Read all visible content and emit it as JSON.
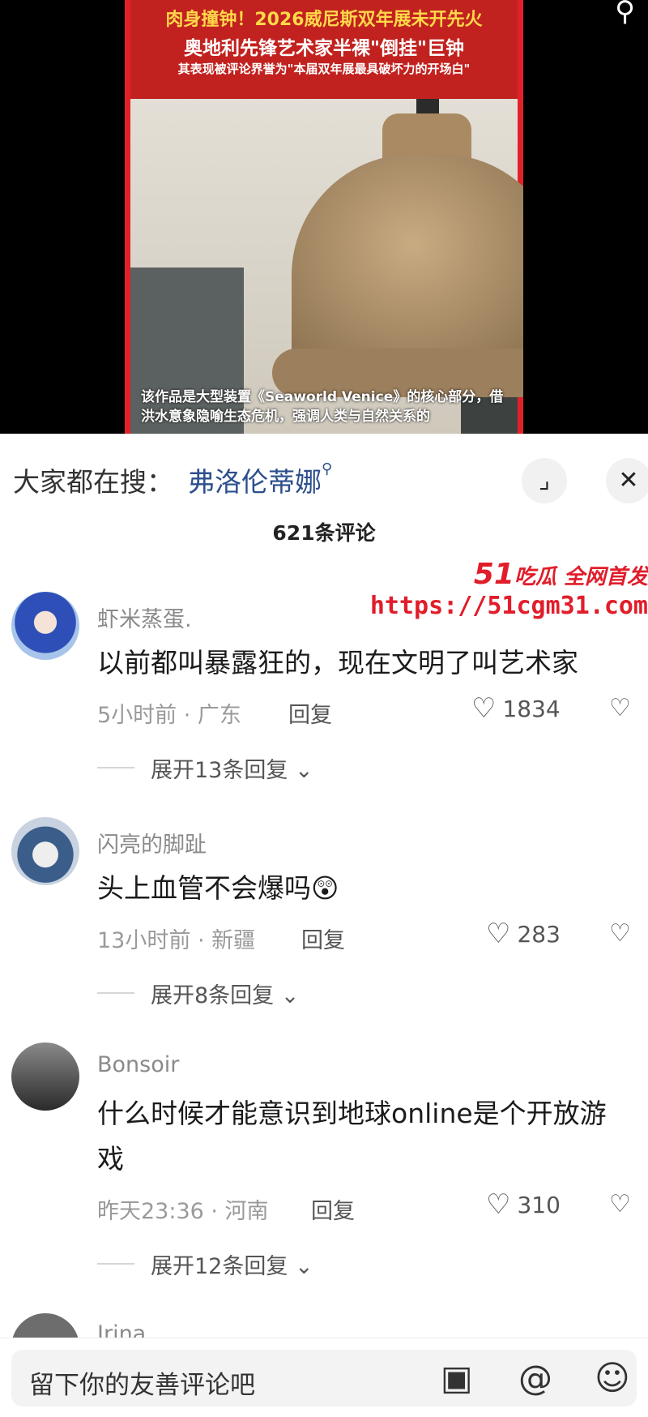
{
  "video": {
    "title_line1": "肉身撞钟！2026威尼斯双年展未开先火",
    "title_line2": "奥地利先锋艺术家半裸\"倒挂\"巨钟",
    "title_line3": "其表现被评论界誉为\"本届双年展最具破坏力的开场白\"",
    "subtitle": "该作品是大型装置《Seaworld Venice》的核心部分，借洪水意象隐喻生态危机，强调人类与自然关系的",
    "search_icon": "search-icon"
  },
  "trending": {
    "label": "大家都在搜：",
    "keyword": "弗洛伦蒂娜",
    "expand_icon": "expand-icon",
    "close_icon": "close-icon"
  },
  "comments_header": {
    "count": "621条评论"
  },
  "watermark": {
    "line1_num": "51",
    "line1_text": "吃瓜 全网首发",
    "line2": "https://51cgm31.com"
  },
  "comments": [
    {
      "user": "虾米蒸蛋.",
      "text": "以前都叫暴露狂的，现在文明了叫艺术家",
      "meta": "5小时前 · 广东",
      "reply": "回复",
      "likes": "1834",
      "expand": "展开13条回复"
    },
    {
      "user": "闪亮的脚趾",
      "text": "头上血管不会爆吗😲",
      "meta": "13小时前 · 新疆",
      "reply": "回复",
      "likes": "283",
      "expand": "展开8条回复"
    },
    {
      "user": "Bonsoir",
      "text": "什么时候才能意识到地球online是个开放游戏",
      "meta": "昨天23:36 · 河南",
      "reply": "回复",
      "likes": "310",
      "expand": "展开12条回复"
    },
    {
      "user": "Irina"
    }
  ],
  "bottom_bar": {
    "placeholder": "留下你的友善评论吧",
    "image_icon": "image-icon",
    "mention_icon": "at-icon",
    "emoji_icon": "emoji-icon"
  }
}
